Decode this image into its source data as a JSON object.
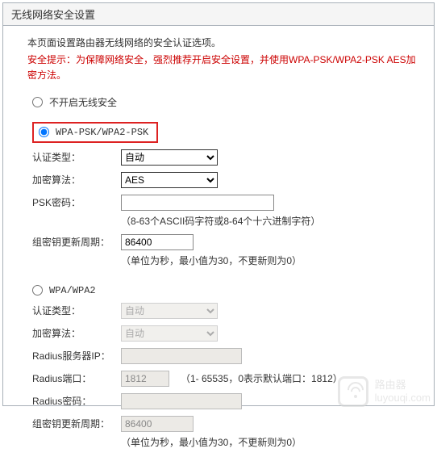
{
  "panel_title": "无线网络安全设置",
  "intro": "本页面设置路由器无线网络的安全认证选项。",
  "warning": "安全提示：为保障网络安全，强烈推荐开启安全设置，并使用WPA-PSK/WPA2-PSK AES加密方法。",
  "options": {
    "none": "不开启无线安全",
    "psk": "WPA-PSK/WPA2-PSK",
    "wpa": "WPA/WPA2"
  },
  "labels": {
    "auth_type": "认证类型：",
    "enc_algo": "加密算法：",
    "psk_pwd": "PSK密码：",
    "group_key": "组密钥更新周期：",
    "radius_ip": "Radius服务器IP：",
    "radius_port": "Radius端口：",
    "radius_pwd": "Radius密码："
  },
  "selects": {
    "auto": "自动",
    "aes": "AES"
  },
  "psk": {
    "value": "",
    "hint": "（8-63个ASCII码字符或8-64个十六进制字符）",
    "group_key_value": "86400",
    "group_key_hint": "（单位为秒，最小值为30，不更新则为0）"
  },
  "wpa": {
    "radius_ip_value": "",
    "radius_port_value": "1812",
    "radius_port_hint": "（1- 65535，0表示默认端口：1812）",
    "radius_pwd_value": "",
    "group_key_value": "86400",
    "group_key_hint": "（单位为秒，最小值为30，不更新则为0）"
  },
  "watermark": {
    "line1": "路由器",
    "line2": "luyouqi.com"
  }
}
